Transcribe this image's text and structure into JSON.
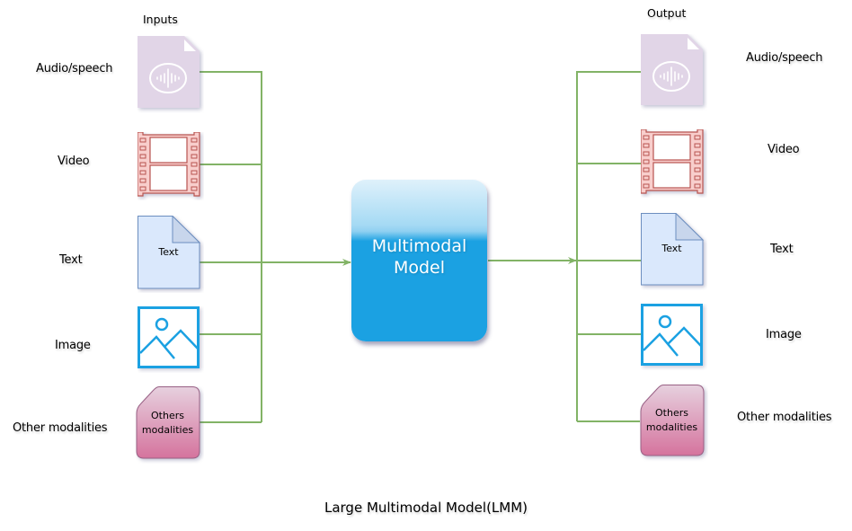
{
  "diagram": {
    "title": "Large Multimodal Model(LMM)",
    "model": {
      "line1": "Multimodal",
      "line2": "Model",
      "color": "#1ba1e2"
    },
    "connector_color": "#82b366",
    "inputs": {
      "header": "Inputs",
      "items": [
        {
          "label": "Audio/speech",
          "icon": "audio-file-icon"
        },
        {
          "label": "Video",
          "icon": "film-strip-icon"
        },
        {
          "label": "Text",
          "icon": "text-document-icon",
          "icon_text": "Text"
        },
        {
          "label": "Image",
          "icon": "image-icon"
        },
        {
          "label": "Other modalities",
          "icon": "other-modalities-card",
          "icon_text_1": "Others",
          "icon_text_2": "modalities"
        }
      ]
    },
    "outputs": {
      "header": "Output",
      "items": [
        {
          "label": "Audio/speech",
          "icon": "audio-file-icon"
        },
        {
          "label": "Video",
          "icon": "film-strip-icon"
        },
        {
          "label": "Text",
          "icon": "text-document-icon",
          "icon_text": "Text"
        },
        {
          "label": "Image",
          "icon": "image-icon"
        },
        {
          "label": "Other modalities",
          "icon": "other-modalities-card",
          "icon_text_1": "Others",
          "icon_text_2": "modalities"
        }
      ]
    },
    "icon_colors": {
      "audio_fill": "#e1d5e7",
      "film_fill": "#f8cecc",
      "film_stroke": "#b85450",
      "text_doc_fill": "#dae8fc",
      "text_doc_stroke": "#6c8ebf",
      "image_stroke": "#1ba1e2",
      "others_top": "#e6d0de",
      "others_bottom": "#d5739d",
      "others_stroke": "#996185"
    }
  }
}
